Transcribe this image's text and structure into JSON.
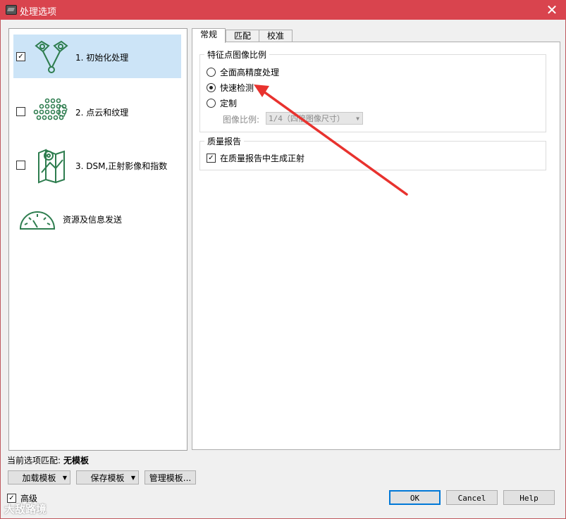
{
  "window": {
    "title": "处理选项",
    "close_glyph": "✕"
  },
  "steps": [
    {
      "label": "1. 初始化处理",
      "checked": true,
      "icon": "camera-tiepoints-icon"
    },
    {
      "label": "2. 点云和纹理",
      "checked": false,
      "icon": "point-cloud-icon"
    },
    {
      "label": "3. DSM,正射影像和指数",
      "checked": false,
      "icon": "map-pin-icon"
    },
    {
      "label": "资源及信息发送",
      "icon": "gauge-icon"
    }
  ],
  "tabs": [
    "常规",
    "匹配",
    "校准"
  ],
  "feature_scale": {
    "title": "特征点图像比例",
    "options": [
      "全面高精度处理",
      "快速检测",
      "定制"
    ],
    "selected": 1,
    "image_scale_label": "图像比例:",
    "image_scale_value": "1/4（四倍图像尺寸）"
  },
  "quality_report": {
    "title": "质量报告",
    "option": "在质量报告中生成正射",
    "checked": true
  },
  "footer": {
    "current_template_label": "当前选项匹配:",
    "current_template_value": "无模板",
    "load_template": "加载模板",
    "save_template": "保存模板",
    "manage_template": "管理模板...",
    "advanced_label": "高级",
    "advanced_checked": true,
    "ok": "OK",
    "cancel": "Cancel",
    "help": "Help"
  },
  "check_glyph": "☑",
  "watermark": "大敌路境",
  "colors": {
    "titlebar": "#d9444e",
    "selected_step": "#cce4f7",
    "icon_green": "#2e7d4f",
    "annotation_arrow": "#e8322e"
  }
}
